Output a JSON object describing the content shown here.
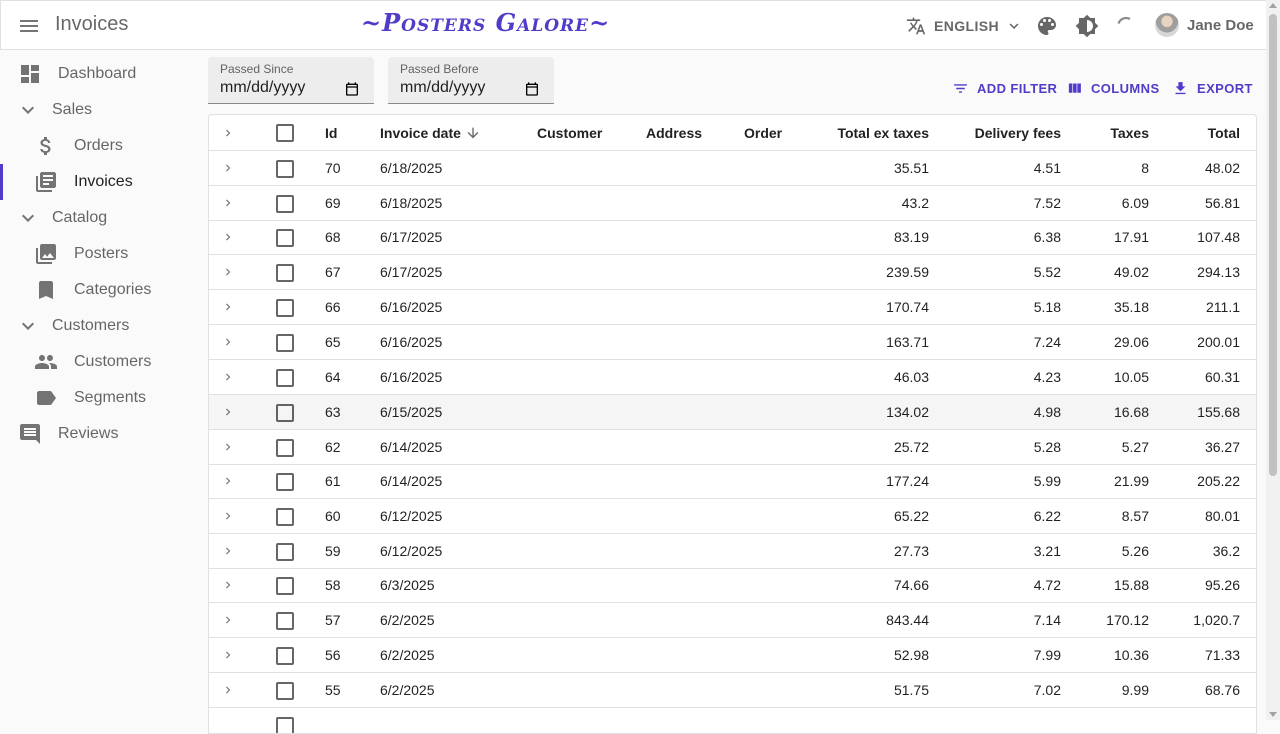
{
  "header": {
    "title": "Invoices",
    "logo_text": "~Posters Galore~",
    "language": "ENGLISH",
    "user_name": "Jane Doe"
  },
  "sidebar": {
    "items": [
      {
        "label": "Dashboard",
        "icon": "dashboard-icon"
      },
      {
        "label": "Sales",
        "icon": "chevron-down-icon"
      },
      {
        "label": "Orders",
        "icon": "dollar-icon"
      },
      {
        "label": "Invoices",
        "icon": "invoices-icon",
        "active": true
      },
      {
        "label": "Catalog",
        "icon": "chevron-down-icon"
      },
      {
        "label": "Posters",
        "icon": "image-icon"
      },
      {
        "label": "Categories",
        "icon": "bookmark-icon"
      },
      {
        "label": "Customers",
        "icon": "chevron-down-icon"
      },
      {
        "label": "Customers",
        "icon": "people-icon"
      },
      {
        "label": "Segments",
        "icon": "label-icon"
      },
      {
        "label": "Reviews",
        "icon": "comment-icon"
      }
    ]
  },
  "filters": {
    "passed_since": {
      "label": "Passed Since",
      "value": "mm/dd/yyyy"
    },
    "passed_before": {
      "label": "Passed Before",
      "value": "mm/dd/yyyy"
    }
  },
  "toolbar": {
    "add_filter": "ADD FILTER",
    "columns": "COLUMNS",
    "export": "EXPORT"
  },
  "table": {
    "columns": [
      "Id",
      "Invoice date",
      "Customer",
      "Address",
      "Order",
      "Total ex taxes",
      "Delivery fees",
      "Taxes",
      "Total"
    ],
    "rows": [
      {
        "id": "70",
        "date": "6/18/2025",
        "customer": "",
        "address": "",
        "order": "",
        "total_ex_taxes": "35.51",
        "delivery_fees": "4.51",
        "taxes": "8",
        "total": "48.02"
      },
      {
        "id": "69",
        "date": "6/18/2025",
        "customer": "",
        "address": "",
        "order": "",
        "total_ex_taxes": "43.2",
        "delivery_fees": "7.52",
        "taxes": "6.09",
        "total": "56.81"
      },
      {
        "id": "68",
        "date": "6/17/2025",
        "customer": "",
        "address": "",
        "order": "",
        "total_ex_taxes": "83.19",
        "delivery_fees": "6.38",
        "taxes": "17.91",
        "total": "107.48"
      },
      {
        "id": "67",
        "date": "6/17/2025",
        "customer": "",
        "address": "",
        "order": "",
        "total_ex_taxes": "239.59",
        "delivery_fees": "5.52",
        "taxes": "49.02",
        "total": "294.13"
      },
      {
        "id": "66",
        "date": "6/16/2025",
        "customer": "",
        "address": "",
        "order": "",
        "total_ex_taxes": "170.74",
        "delivery_fees": "5.18",
        "taxes": "35.18",
        "total": "211.1"
      },
      {
        "id": "65",
        "date": "6/16/2025",
        "customer": "",
        "address": "",
        "order": "",
        "total_ex_taxes": "163.71",
        "delivery_fees": "7.24",
        "taxes": "29.06",
        "total": "200.01"
      },
      {
        "id": "64",
        "date": "6/16/2025",
        "customer": "",
        "address": "",
        "order": "",
        "total_ex_taxes": "46.03",
        "delivery_fees": "4.23",
        "taxes": "10.05",
        "total": "60.31"
      },
      {
        "id": "63",
        "date": "6/15/2025",
        "customer": "",
        "address": "",
        "order": "",
        "total_ex_taxes": "134.02",
        "delivery_fees": "4.98",
        "taxes": "16.68",
        "total": "155.68",
        "highlight": true
      },
      {
        "id": "62",
        "date": "6/14/2025",
        "customer": "",
        "address": "",
        "order": "",
        "total_ex_taxes": "25.72",
        "delivery_fees": "5.28",
        "taxes": "5.27",
        "total": "36.27"
      },
      {
        "id": "61",
        "date": "6/14/2025",
        "customer": "",
        "address": "",
        "order": "",
        "total_ex_taxes": "177.24",
        "delivery_fees": "5.99",
        "taxes": "21.99",
        "total": "205.22"
      },
      {
        "id": "60",
        "date": "6/12/2025",
        "customer": "",
        "address": "",
        "order": "",
        "total_ex_taxes": "65.22",
        "delivery_fees": "6.22",
        "taxes": "8.57",
        "total": "80.01"
      },
      {
        "id": "59",
        "date": "6/12/2025",
        "customer": "",
        "address": "",
        "order": "",
        "total_ex_taxes": "27.73",
        "delivery_fees": "3.21",
        "taxes": "5.26",
        "total": "36.2"
      },
      {
        "id": "58",
        "date": "6/3/2025",
        "customer": "",
        "address": "",
        "order": "",
        "total_ex_taxes": "74.66",
        "delivery_fees": "4.72",
        "taxes": "15.88",
        "total": "95.26"
      },
      {
        "id": "57",
        "date": "6/2/2025",
        "customer": "",
        "address": "",
        "order": "",
        "total_ex_taxes": "843.44",
        "delivery_fees": "7.14",
        "taxes": "170.12",
        "total": "1,020.7"
      },
      {
        "id": "56",
        "date": "6/2/2025",
        "customer": "",
        "address": "",
        "order": "",
        "total_ex_taxes": "52.98",
        "delivery_fees": "7.99",
        "taxes": "10.36",
        "total": "71.33"
      },
      {
        "id": "55",
        "date": "6/2/2025",
        "customer": "",
        "address": "",
        "order": "",
        "total_ex_taxes": "51.75",
        "delivery_fees": "7.02",
        "taxes": "9.99",
        "total": "68.76"
      }
    ]
  },
  "colors": {
    "accent": "#4f3cc9",
    "row_highlight": "#f5f5f5"
  }
}
